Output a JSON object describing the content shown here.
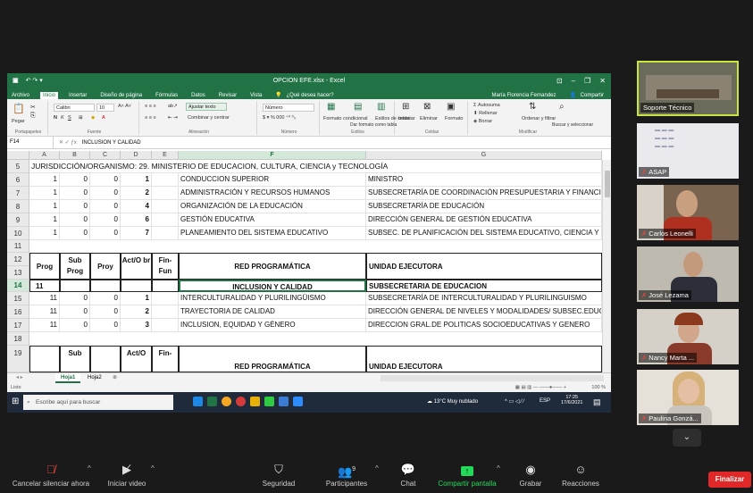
{
  "excel": {
    "filename": "OPCION EFE.xlsx - Excel",
    "user": "María Florencia Fernandez",
    "share": "Compartir",
    "tell_me": "¿Qué desea hacer?",
    "menu": [
      "Archivo",
      "Inicio",
      "Insertar",
      "Diseño de página",
      "Fórmulas",
      "Datos",
      "Revisar",
      "Vista"
    ],
    "ribbon": {
      "font_name": "Calibri",
      "font_size": "10",
      "wrap_text": "Ajustar texto",
      "merge": "Combinar y centrar",
      "number_format": "Número",
      "conditional": "Formato condicional",
      "as_table": "Dar formato como tabla",
      "styles": "Estilos de celda",
      "insert": "Insertar",
      "delete": "Eliminar",
      "format": "Formato",
      "autosum": "Autosuma",
      "fill": "Rellenar",
      "clear": "Borrar",
      "sort": "Ordenar y filtrar",
      "find": "Buscar y seleccionar",
      "groups": [
        "Portapapeles",
        "Fuente",
        "Alineación",
        "Número",
        "Estilos",
        "Celdas",
        "Modificar"
      ],
      "paste": "Pegar"
    },
    "name_box": "F14",
    "formula_value": "INCLUSION Y CALIDAD",
    "columns": [
      "A",
      "B",
      "C",
      "D",
      "E",
      "F",
      "G"
    ],
    "row5": {
      "num": "5",
      "text": "JURISDICCIÓN/ORGANISMO: 29. MINISTERIO DE EDUCACION, CULTURA, CIENCIA y TECNOLOGÍA"
    },
    "rows_top": [
      {
        "num": "6",
        "a": "1",
        "b": "0",
        "c": "0",
        "d": "1",
        "f": "CONDUCCION SUPERIOR",
        "g": "MINISTRO"
      },
      {
        "num": "7",
        "a": "1",
        "b": "0",
        "c": "0",
        "d": "2",
        "f": "ADMINISTRACIÓN Y RECURSOS HUMANOS",
        "g": "SUBSECRETARÍA DE COORDINACIÓN PRESUPUESTARIA Y FINANCI"
      },
      {
        "num": "8",
        "a": "1",
        "b": "0",
        "c": "0",
        "d": "4",
        "f": "ORGANIZACIÓN DE LA EDUCACIÓN",
        "g": "SUBSECRETARÍA DE EDUCACIÓN"
      },
      {
        "num": "9",
        "a": "1",
        "b": "0",
        "c": "0",
        "d": "6",
        "f": "GESTIÓN EDUCATIVA",
        "g": "DIRECCIÓN GENERAL DE GESTIÓN EDUCATIVA"
      },
      {
        "num": "10",
        "a": "1",
        "b": "0",
        "c": "0",
        "d": "7",
        "f": "PLANEAMIENTO DEL SISTEMA EDUCATIVO",
        "g": "SUBSEC. DE PLANIFICACIÓN DEL SISTEMA EDUCATIVO, CIENCIA Y"
      }
    ],
    "row11": "11",
    "header_rows": [
      "12",
      "13"
    ],
    "headers": {
      "prog": "Prog",
      "subprog": "Sub Prog",
      "proy": "Proy",
      "act": "Act/O br",
      "fin": "Fin-Fun",
      "red": "RED PROGRAMÁTICA",
      "unidad": "UNIDAD EJECUTORA"
    },
    "row14": {
      "num": "14",
      "a": "11",
      "f": "INCLUSION Y CALIDAD",
      "g": "SUBSECRETARIA DE EDUCACION"
    },
    "rows_bottom": [
      {
        "num": "15",
        "a": "11",
        "b": "0",
        "c": "0",
        "d": "1",
        "f": "INTERCULTURALIDAD Y PLURILINGÜISMO",
        "g": "SUBSECRETARÍA DE INTERCULTURALIDAD Y PLURILINGUISMO"
      },
      {
        "num": "16",
        "a": "11",
        "b": "0",
        "c": "0",
        "d": "2",
        "f": "TRAYECTORIA DE CALIDAD",
        "g": "DIRECCIÓN GENERAL DE NIVELES Y MODALIDADES/ SUBSEC.EDUC"
      },
      {
        "num": "17",
        "a": "11",
        "b": "0",
        "c": "0",
        "d": "3",
        "f": "INCLUSION, EQUIDAD Y GÉNERO",
        "g": "DIRECCION GRAL.DE POLITICAS SOCIOEDUCATIVAS Y GENERO"
      }
    ],
    "row18": "18",
    "row19": {
      "num": "19",
      "b": "Sub",
      "d": "Act/O",
      "e": "Fin-",
      "f": "RED PROGRAMÁTICA",
      "g": "UNIDAD EJECUTORA"
    },
    "sheets": [
      "Hoja1",
      "Hoja2"
    ],
    "status": "Listo",
    "zoom": "100 %"
  },
  "taskbar": {
    "search_placeholder": "Escribe aquí para buscar",
    "weather": "13°C Muy nublado",
    "lang": "ESP",
    "time": "17:25",
    "date": "17/6/2021"
  },
  "participants": [
    {
      "name": "Soporte Técnico",
      "muted": false
    },
    {
      "name": "ASAP",
      "muted": true
    },
    {
      "name": "Carlos Leonelli",
      "muted": true
    },
    {
      "name": "José Lezama",
      "muted": true
    },
    {
      "name": "Nancy Marta ...",
      "muted": true
    },
    {
      "name": "Paulina Gonzá...",
      "muted": true
    }
  ],
  "toolbar": {
    "mute": "Cancelar silenciar ahora",
    "video": "Iniciar video",
    "security": "Seguridad",
    "participants": "Participantes",
    "participants_count": "9",
    "chat": "Chat",
    "share": "Compartir pantalla",
    "record": "Grabar",
    "reactions": "Reacciones",
    "end": "Finalizar"
  },
  "colors": {
    "excel_green": "#217346",
    "share_green": "#23d959",
    "end_red": "#e02828",
    "speaker_border": "#c8e63c"
  }
}
